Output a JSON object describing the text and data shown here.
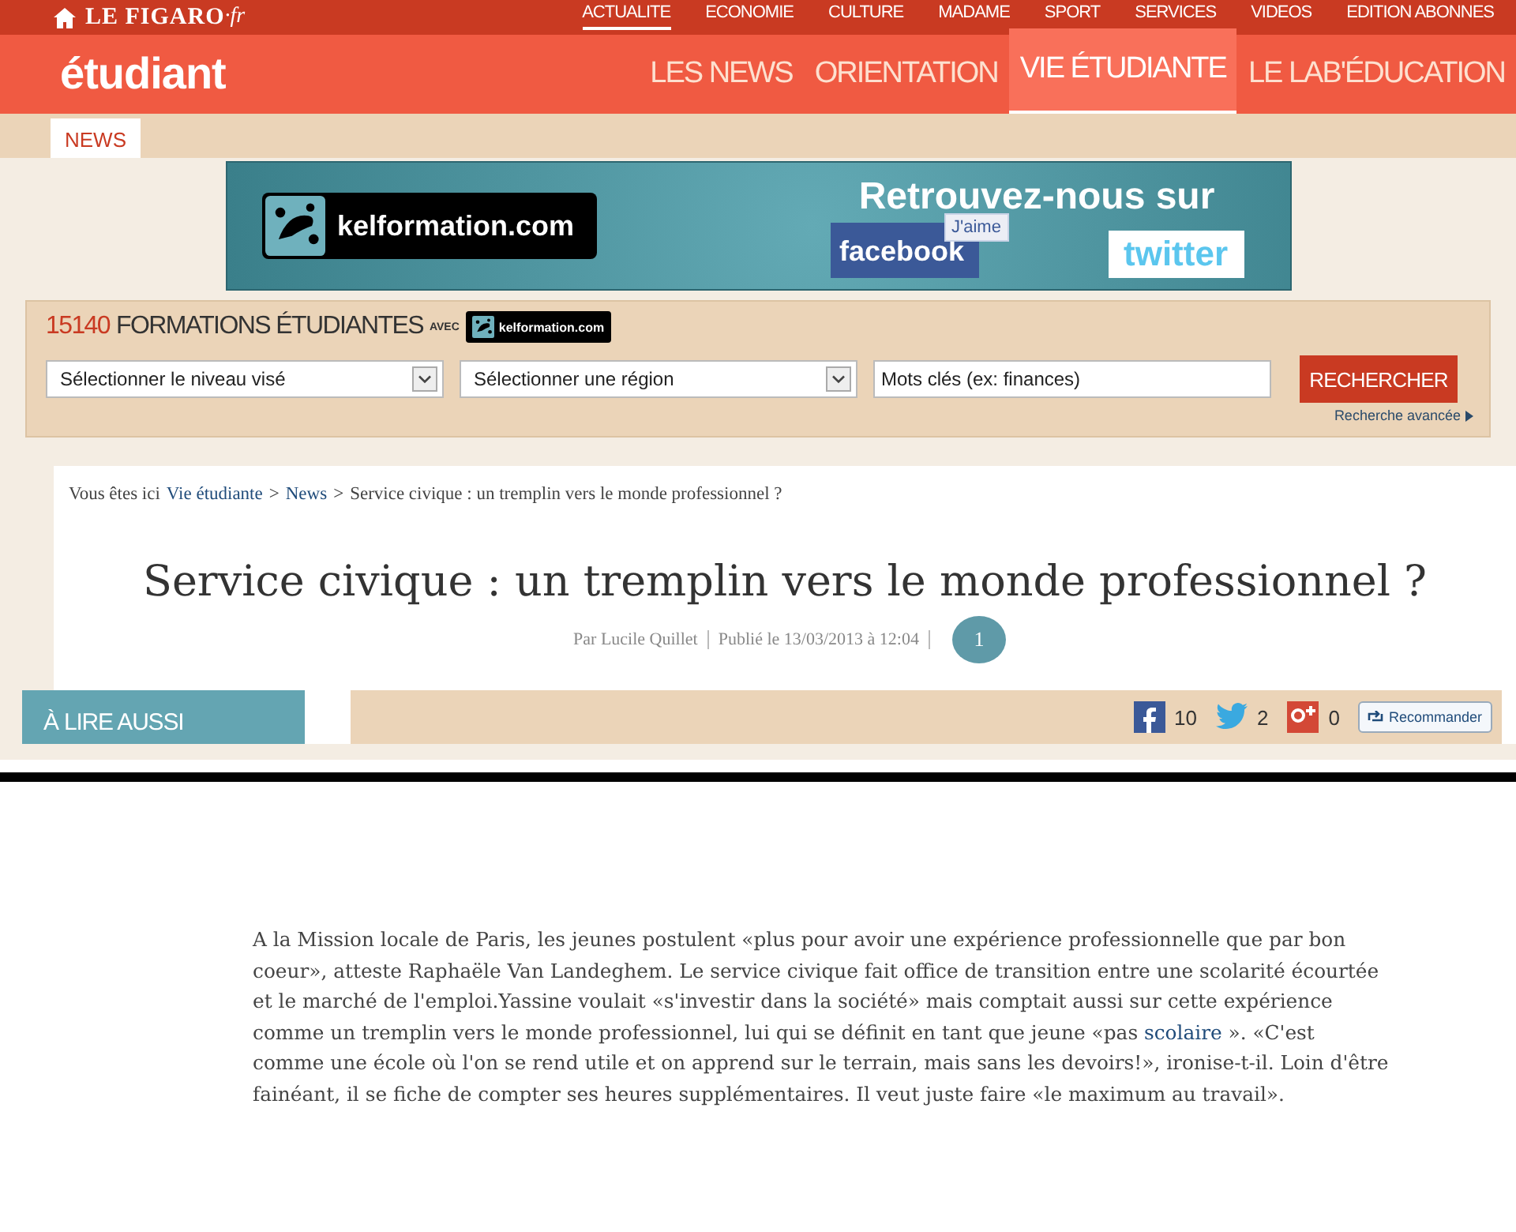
{
  "top_bar": {
    "brand": "LE FIGARO",
    "brand_suffix": "·fr",
    "links": [
      {
        "label": "ACTUALITE",
        "selected": true
      },
      {
        "label": "ECONOMIE",
        "selected": false
      },
      {
        "label": "CULTURE",
        "selected": false
      },
      {
        "label": "MADAME",
        "selected": false
      },
      {
        "label": "SPORT",
        "selected": false
      },
      {
        "label": "SERVICES",
        "selected": false
      },
      {
        "label": "VIDEOS",
        "selected": false
      },
      {
        "label": "EDITION ABONNES",
        "selected": false
      }
    ]
  },
  "header": {
    "logo": "étudiant",
    "nav": [
      {
        "label": "LES NEWS",
        "selected": false
      },
      {
        "label": "ORIENTATION",
        "selected": false
      },
      {
        "label": "VIE ÉTUDIANTE",
        "selected": true
      },
      {
        "label": "LE LAB'ÉDUCATION",
        "selected": false
      }
    ]
  },
  "subnav": [
    {
      "label": "NEWS",
      "selected": true
    }
  ],
  "banner": {
    "logo": "kelformation.com",
    "headline": "Retrouvez-nous sur",
    "facebook": "facebook",
    "like": "J'aime",
    "twitter": "twitter"
  },
  "search": {
    "count": "15140",
    "title": "FORMATIONS ÉTUDIANTES",
    "with": "AVEC",
    "logo": "kelformation.com",
    "level_select": "Sélectionner le niveau visé",
    "region_select": "Sélectionner une région",
    "keywords": {
      "placeholder": "Mots clés (ex: finances)"
    },
    "button": "RECHERCHER",
    "advanced": "Recherche avancée"
  },
  "breadcrumb": {
    "prefix": "Vous êtes ici",
    "items": [
      {
        "label": "Vie étudiante",
        "kind": "link"
      },
      {
        "label": ">",
        "kind": "sep"
      },
      {
        "label": "News",
        "kind": "link"
      },
      {
        "label": ">",
        "kind": "sep"
      },
      {
        "label": "Service civique : un tremplin vers le monde professionnel ?",
        "kind": "text"
      }
    ]
  },
  "article": {
    "title": "Service civique : un tremplin vers le monde professionnel ?",
    "author": "Par Lucile Quillet",
    "published": "Publié le 13/03/2013 à  12:04",
    "comments": "1"
  },
  "read_also": "À LIRE AUSSI",
  "share": {
    "facebook": "10",
    "twitter": "2",
    "google": "0",
    "recommend": "Recommander"
  },
  "paragraph": {
    "before": "A la Mission locale de Paris, les jeunes postulent «plus pour avoir une expérience professionnelle que par bon coeur», atteste Raphaële Van Landeghem. Le service civique fait office de transition entre une scolarité écourtée et le marché de l'emploi.Yassine voulait «s'investir dans la société» mais comptait aussi sur cette expérience comme un tremplin vers le monde professionnel, lui qui se définit en tant que jeune «pas ",
    "link": "scolaire",
    "after": " ». «C'est comme une école où l'on se rend utile et on apprend sur le terrain, mais sans les devoirs!», ironise-t-il. Loin d'être fainéant, il se fiche de compter ses heures supplémentaires. Il veut juste faire «le maximum au travail»."
  }
}
